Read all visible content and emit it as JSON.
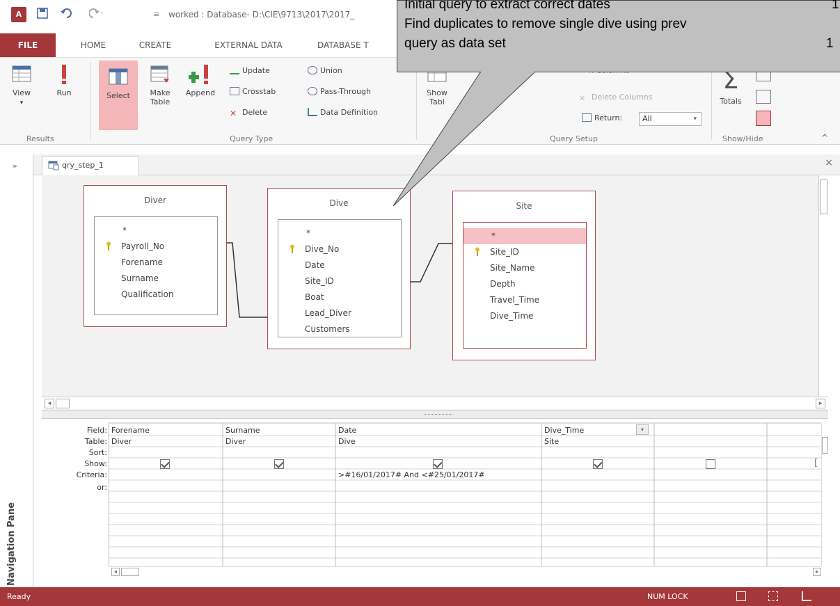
{
  "window": {
    "title": "worked : Database- D:\\CIE\\9713\\2017\\2017_",
    "logo": "A"
  },
  "callout": {
    "lines": [
      {
        "text": "Initial query to extract correct dates",
        "num": "1"
      },
      {
        "text": "Find duplicates to remove single dive using prev",
        "num": ""
      },
      {
        "text": "query as data set",
        "num": "1"
      }
    ]
  },
  "tabs": [
    "FILE",
    "HOME",
    "CREATE",
    "EXTERNAL DATA",
    "DATABASE T"
  ],
  "ribbon": {
    "results": {
      "label": "Results",
      "view": "View",
      "run": "Run"
    },
    "query_type": {
      "label": "Query Type",
      "select": "Select",
      "make_table": "Make Table",
      "append": "Append",
      "update": "Update",
      "crosstab": "Crosstab",
      "delete": "Delete",
      "union": "Union",
      "pass_through": "Pass-Through",
      "data_definition": "Data Definition"
    },
    "show_table": "Show Tabl",
    "query_setup": {
      "label": "Query Setup",
      "insert_columns": "n Columns",
      "delete_columns": "Delete Columns",
      "return_label": "Return:",
      "return_value": "All"
    },
    "show_hide": {
      "label": "Show/Hide",
      "totals": "Totals"
    }
  },
  "nav_pane": {
    "label": "Navigation Pane"
  },
  "document_tab": {
    "label": "qry_step_1"
  },
  "tables": [
    {
      "name": "Diver",
      "fields": [
        "*",
        "Payroll_No",
        "Forename",
        "Surname",
        "Qualification"
      ],
      "key": "Payroll_No"
    },
    {
      "name": "Dive",
      "fields": [
        "*",
        "Dive_No",
        "Date",
        "Site_ID",
        "Boat",
        "Lead_Diver",
        "Customers"
      ],
      "key": "Dive_No"
    },
    {
      "name": "Site",
      "fields": [
        "*",
        "Site_ID",
        "Site_Name",
        "Depth",
        "Travel_Time",
        "Dive_Time"
      ],
      "key": "Site_ID"
    }
  ],
  "qbe": {
    "row_labels": [
      "Field:",
      "Table:",
      "Sort:",
      "Show:",
      "Criteria:",
      "or:"
    ],
    "columns": [
      {
        "field": "Forename",
        "table": "Diver",
        "show": true,
        "criteria": ""
      },
      {
        "field": "Surname",
        "table": "Diver",
        "show": true,
        "criteria": ""
      },
      {
        "field": "Date",
        "table": "Dive",
        "show": true,
        "criteria": ">#16/01/2017# And <#25/01/2017#"
      },
      {
        "field": "Dive_Time",
        "table": "Site",
        "show": true,
        "criteria": ""
      },
      {
        "field": "",
        "table": "",
        "show": false,
        "criteria": ""
      }
    ]
  },
  "status": {
    "text": "Ready",
    "numlock": "NUM LOCK"
  },
  "colors": {
    "access_red": "#a4373a",
    "selected_pink": "#f4b6b8"
  }
}
